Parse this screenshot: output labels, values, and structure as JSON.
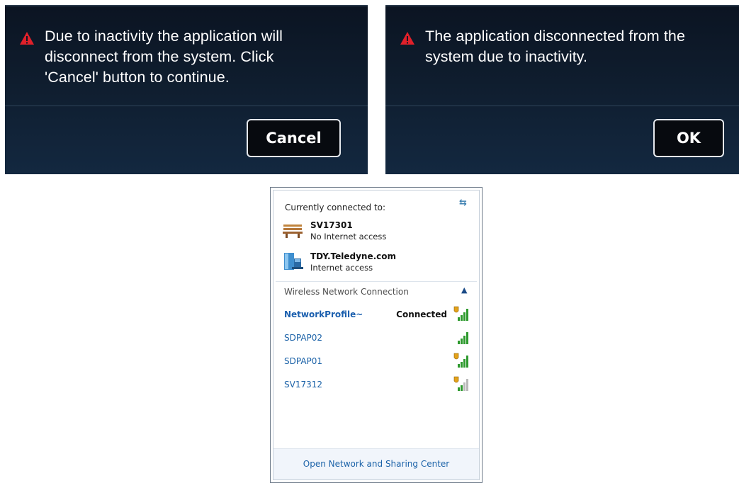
{
  "dialog_inactivity_warning": {
    "message": "Due to inactivity the application will\ndisconnect from the system. Click\n'Cancel' button to continue.",
    "button_label": "Cancel",
    "icon": "warning-triangle-icon",
    "accent": "#e0202a"
  },
  "dialog_disconnected": {
    "message": "The application disconnected from the\nsystem due to inactivity.",
    "button_label": "OK",
    "icon": "warning-triangle-icon",
    "accent": "#e0202a"
  },
  "network_flyout": {
    "currently_connected_label": "Currently connected to:",
    "connections": [
      {
        "name": "SV17301",
        "status": "No Internet access",
        "icon": "bench-network-icon"
      },
      {
        "name": "TDY.Teledyne.com",
        "status": "Internet access",
        "icon": "domain-network-icon"
      }
    ],
    "section_label": "Wireless Network Connection",
    "wifi_networks": [
      {
        "name": "NetworkProfile~",
        "status": "Connected",
        "secured": true,
        "signal_bars": 5
      },
      {
        "name": "SDPAP02",
        "status": "",
        "secured": false,
        "signal_bars": 5
      },
      {
        "name": "SDPAP01",
        "status": "",
        "secured": true,
        "signal_bars": 5
      },
      {
        "name": "SV17312",
        "status": "",
        "secured": true,
        "signal_bars": 2
      }
    ],
    "footer_link": "Open Network and Sharing Center"
  }
}
